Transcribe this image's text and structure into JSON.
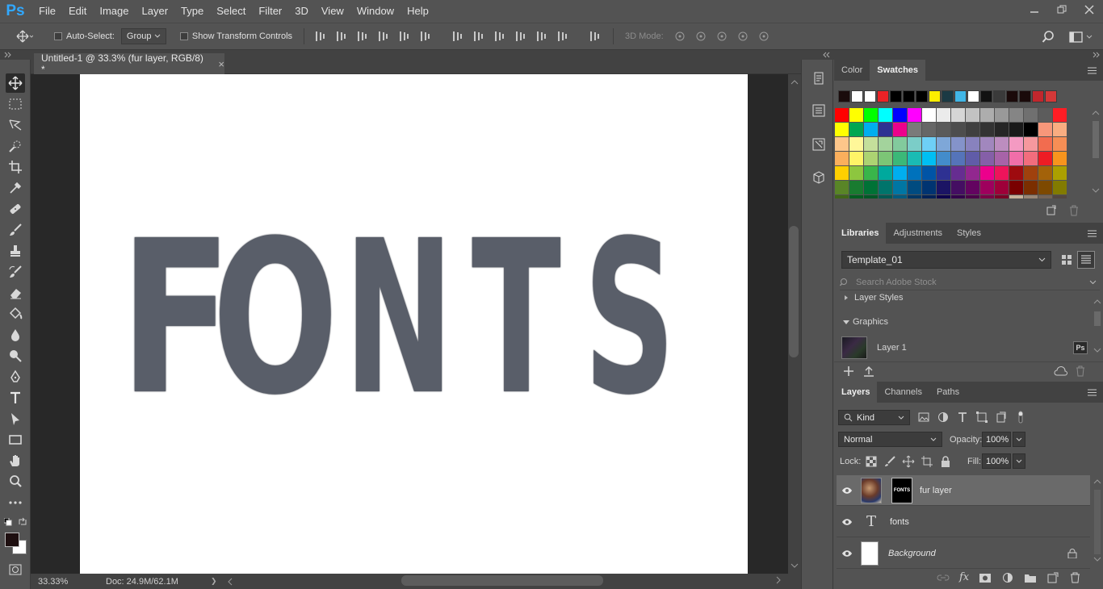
{
  "app": {
    "logo": "Ps"
  },
  "menu": [
    "File",
    "Edit",
    "Image",
    "Layer",
    "Type",
    "Select",
    "Filter",
    "3D",
    "View",
    "Window",
    "Help"
  ],
  "options": {
    "auto_select_label": "Auto-Select:",
    "auto_select_value": "Group",
    "transform_label": "Show Transform Controls",
    "mode_3d_label": "3D Mode:"
  },
  "document": {
    "tab_title": "Untitled-1 @ 33.3% (fur layer, RGB/8) *",
    "close": "×",
    "canvas_text": [
      "F",
      "O",
      "N",
      "T",
      "S"
    ]
  },
  "status": {
    "zoom": "33.33%",
    "doc": "Doc: 24.9M/62.1M",
    "arrow": "❯"
  },
  "swatches_panel": {
    "tabs": [
      "Color",
      "Swatches"
    ],
    "active_tab": "Swatches",
    "recent": [
      "#1a0c0c",
      "#ffffff",
      "#ffffff",
      "#ea2226",
      "#000000",
      "#000000",
      "#000000",
      "#fdee00",
      "#1b3a44",
      "#41b6e6",
      "#ffffff",
      "#111111",
      "#3a3a3a",
      "#1a0a0a",
      "#1a0a0a",
      "#c1272d",
      "#d43838"
    ],
    "grid": [
      [
        "#ff0000",
        "#ffff00",
        "#00ff00",
        "#00ffff",
        "#0000ff",
        "#ff00ff",
        "#ffffff",
        "#ebebeb",
        "#d6d6d6",
        "#c2c2c2",
        "#adadad",
        "#999999",
        "#858585",
        "#707070",
        "#5c5c5c",
        "#ff1d25"
      ],
      [
        "#ffff00",
        "#00a651",
        "#00aeef",
        "#2e3192",
        "#ec008c",
        "#7a7a7a",
        "#666666",
        "#5a5a5a",
        "#4d4d4d",
        "#404040",
        "#333333",
        "#262626",
        "#1a1a1a",
        "#000000",
        "#f7977a",
        "#f9ad81"
      ],
      [
        "#fdc68a",
        "#fff799",
        "#c4df9b",
        "#a3d39c",
        "#82ca9d",
        "#7bcdc8",
        "#6ecff6",
        "#7ea7d8",
        "#8493ca",
        "#8882be",
        "#a187be",
        "#bc8dbf",
        "#f49ac2",
        "#f6989d",
        "#f26c4f",
        "#f68e55"
      ],
      [
        "#fbaf5c",
        "#fff467",
        "#acd372",
        "#7cc576",
        "#3bb878",
        "#1abbb4",
        "#00bff3",
        "#438ccb",
        "#5574b9",
        "#605ca8",
        "#855fa8",
        "#a763a8",
        "#f06ea9",
        "#f26d7d",
        "#ed1c24",
        "#f7941d"
      ],
      [
        "#ffcf00",
        "#8dc63f",
        "#39b54a",
        "#00a99d",
        "#00aeef",
        "#0072bc",
        "#0054a6",
        "#2e3192",
        "#662d91",
        "#92278f",
        "#ec008c",
        "#ed145b",
        "#9e0b0f",
        "#a0410d",
        "#a36209",
        "#aba000"
      ],
      [
        "#598527",
        "#197b30",
        "#007236",
        "#00746b",
        "#0076a3",
        "#004b80",
        "#003471",
        "#1b1464",
        "#440e62",
        "#630460",
        "#9e005d",
        "#9e0039",
        "#790000",
        "#7b2e00",
        "#7d4900",
        "#827b00"
      ],
      [
        "#406618",
        "#005e20",
        "#005826",
        "#005952",
        "#005b7f",
        "#003663",
        "#002157",
        "#0d004c",
        "#32004b",
        "#4b0049",
        "#7b0046",
        "#7a0026",
        "#c7b299",
        "#998675",
        "#736357",
        "#534741"
      ]
    ]
  },
  "libraries_panel": {
    "tabs": [
      "Libraries",
      "Adjustments",
      "Styles"
    ],
    "active_tab": "Libraries",
    "library": "Template_01",
    "search_placeholder": "Search Adobe Stock",
    "section_styles": "Layer Styles",
    "section_graphics": "Graphics",
    "item": "Layer 1",
    "item_badge": "Ps"
  },
  "layers_panel": {
    "tabs": [
      "Layers",
      "Channels",
      "Paths"
    ],
    "active_tab": "Layers",
    "filter": "Kind",
    "blend": "Normal",
    "opacity_label": "Opacity:",
    "opacity": "100%",
    "lock_label": "Lock:",
    "fill_label": "Fill:",
    "fill": "100%",
    "mask_text": "FONTS",
    "type_glyph": "T",
    "layers": [
      {
        "name": "fur layer",
        "selected": true
      },
      {
        "name": "fonts",
        "selected": false
      },
      {
        "name": "Background",
        "selected": false,
        "locked": true
      }
    ],
    "fx_label": "fx"
  },
  "colors": {
    "accent": "#31a8ff",
    "foreground": "#1e0f10",
    "background": "#ffffff"
  }
}
